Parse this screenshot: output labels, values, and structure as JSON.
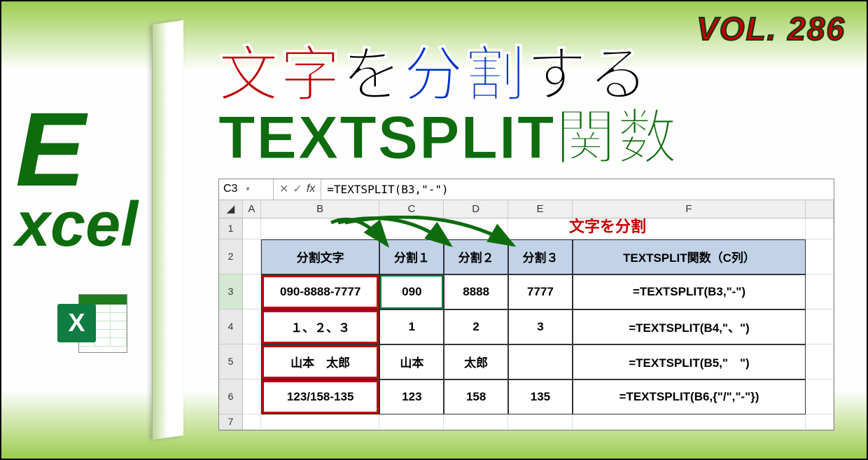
{
  "volume": "VOL. 286",
  "brand": {
    "bigE": "E",
    "rest": "xcel",
    "iconLetter": "X"
  },
  "headline": {
    "p1_red": "文字",
    "p1_black1": "を",
    "p1_blue": "分割",
    "p1_black2": "する",
    "p2_green": "TEXTSPLIT関数"
  },
  "annotation": "文字を分割",
  "formulaBar": {
    "nameBox": "C3",
    "cancel": "✕",
    "confirm": "✓",
    "fx": "fx",
    "formula": "=TEXTSPLIT(B3,\"-\")"
  },
  "columns": [
    "",
    "A",
    "B",
    "C",
    "D",
    "E",
    "F",
    ""
  ],
  "rowNumbers": [
    "1",
    "2",
    "3",
    "4",
    "5",
    "6",
    "7"
  ],
  "chart_data": {
    "type": "table",
    "headers": [
      "分割文字",
      "分割１",
      "分割２",
      "分割３",
      "TEXTSPLIT関数（C列）"
    ],
    "rows": [
      {
        "src": "090-8888-7777",
        "s1": "090",
        "s2": "8888",
        "s3": "7777",
        "formula": "=TEXTSPLIT(B3,\"-\")"
      },
      {
        "src": "１、２、３",
        "s1": "1",
        "s2": "2",
        "s3": "3",
        "formula": "=TEXTSPLIT(B4,\"、\")"
      },
      {
        "src": "山本　太郎",
        "s1": "山本",
        "s2": "太郎",
        "s3": "",
        "formula": "=TEXTSPLIT(B5,\"　\")"
      },
      {
        "src": "123/158-135",
        "s1": "123",
        "s2": "158",
        "s3": "135",
        "formula": "=TEXTSPLIT(B6,{\"/\",\"-\"})"
      }
    ]
  }
}
